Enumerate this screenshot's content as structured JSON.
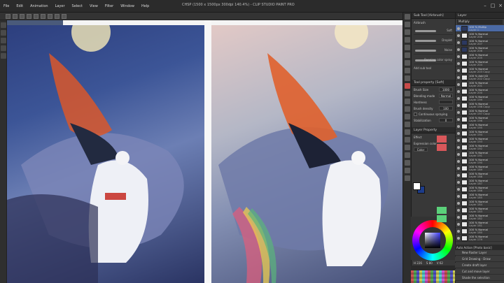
{
  "window": {
    "title": "CHSP (1500 x 1500px 300dpi 140.4%) - CLIP STUDIO PAINT PRO"
  },
  "menu": [
    "File",
    "Edit",
    "Animation",
    "Layer",
    "Select",
    "View",
    "Filter",
    "Window",
    "Help"
  ],
  "sub_tool": {
    "panel_title": "Sub Tool [Airbrush]",
    "group": "Airbrush",
    "brushes": [
      "Soft",
      "Droplet",
      "Noise",
      "Running color spray"
    ],
    "add_label": "Add sub tool"
  },
  "tool_property": {
    "title": "Tool property [Soft]",
    "brush_size_label": "Brush Size",
    "brush_size_value": "1000",
    "blending_label": "Blending mode",
    "blending_value": "Normal",
    "hardness_label": "Hardness",
    "opacity_label": "Brush density",
    "opacity_value": "100",
    "continuous_label": "Continuous spraying",
    "stabilization_label": "Stabilization",
    "stabilization_value": "0"
  },
  "layer_property": {
    "title": "Layer Property",
    "effect_label": "Effect",
    "expression_label": "Expression color",
    "expression_value": "Color"
  },
  "color": {
    "values": [
      "H 226",
      "S 80",
      "V 62"
    ],
    "main": "#ffffff",
    "sub": "#1d3c8a"
  },
  "color_set": {
    "title": "Color Set"
  },
  "layers": {
    "title": "Layer",
    "blend_mode": "Multiply",
    "rows": [
      {
        "name": "100 % Multip",
        "sub": "Layer 1",
        "selected": true,
        "dark": true
      },
      {
        "name": "100 % Normal",
        "sub": "Layer 208",
        "selected": false,
        "dark": false
      },
      {
        "name": "100 % Normal",
        "sub": "Layer 207",
        "selected": false,
        "dark": true
      },
      {
        "name": "100 % Normal",
        "sub": "Layer 206",
        "selected": false,
        "dark": true
      },
      {
        "name": "100 % Normal",
        "sub": "Layer 205",
        "selected": false,
        "dark": false
      },
      {
        "name": "100 % Normal",
        "sub": "Layer 204",
        "selected": false,
        "dark": false
      },
      {
        "name": "100 % Normal",
        "sub": "Layer 203 Copy",
        "selected": false,
        "dark": false
      },
      {
        "name": "100 % Add (Gl",
        "sub": "Layer 202 Copy",
        "selected": false,
        "dark": false
      },
      {
        "name": "100 % Normal",
        "sub": "Layer 201",
        "selected": false,
        "dark": false
      },
      {
        "name": "100 % Normal",
        "sub": "Layer 200",
        "selected": false,
        "dark": false
      },
      {
        "name": "100 % Normal",
        "sub": "Layer 199",
        "selected": false,
        "dark": false
      },
      {
        "name": "100 % Normal",
        "sub": "Layer 198 Copy",
        "selected": false,
        "dark": false
      },
      {
        "name": "100 % Normal",
        "sub": "Layer 197 Copy",
        "selected": false,
        "dark": false
      },
      {
        "name": "100 % Normal",
        "sub": "Layer 196",
        "selected": false,
        "dark": false
      },
      {
        "name": "100 % Normal",
        "sub": "Layer 195",
        "selected": false,
        "dark": false
      },
      {
        "name": "100 % Normal",
        "sub": "Layer 194",
        "selected": false,
        "dark": false
      },
      {
        "name": "100 % Normal",
        "sub": "Layer 193",
        "selected": false,
        "dark": false
      },
      {
        "name": "100 % Normal",
        "sub": "Layer 192",
        "selected": false,
        "dark": false
      },
      {
        "name": "100 % Normal",
        "sub": "Layer 191",
        "selected": false,
        "dark": false
      },
      {
        "name": "100 % Normal",
        "sub": "Layer 190",
        "selected": false,
        "dark": false
      },
      {
        "name": "100 % Normal",
        "sub": "Layer 189",
        "selected": false,
        "dark": false
      },
      {
        "name": "100 % Normal",
        "sub": "Layer 188",
        "selected": false,
        "dark": false
      },
      {
        "name": "100 % Normal",
        "sub": "Layer 187",
        "selected": false,
        "dark": false
      },
      {
        "name": "100 % Normal",
        "sub": "Layer 186",
        "selected": false,
        "dark": false
      },
      {
        "name": "100 % Normal",
        "sub": "Layer 185",
        "selected": false,
        "dark": false
      },
      {
        "name": "100 % Normal",
        "sub": "Layer 184",
        "selected": false,
        "dark": false
      },
      {
        "name": "100 % Normal",
        "sub": "Layer 183",
        "selected": false,
        "dark": false
      },
      {
        "name": "100 % Normal",
        "sub": "Layer 182",
        "selected": false,
        "dark": false
      },
      {
        "name": "100 % Normal",
        "sub": "Layer 181",
        "selected": false,
        "dark": false
      },
      {
        "name": "100 % Normal",
        "sub": "Layer 180",
        "selected": false,
        "dark": false
      },
      {
        "name": "100 % Normal",
        "sub": "Layer 179",
        "selected": false,
        "dark": false
      }
    ]
  },
  "auto_action": {
    "title": "Auto Action [Photo basic]",
    "items": [
      "New Raster Layer",
      "Grid Drawing - Draw",
      "Create draft layer",
      "Cut and move layer",
      "Shade the selection"
    ]
  }
}
